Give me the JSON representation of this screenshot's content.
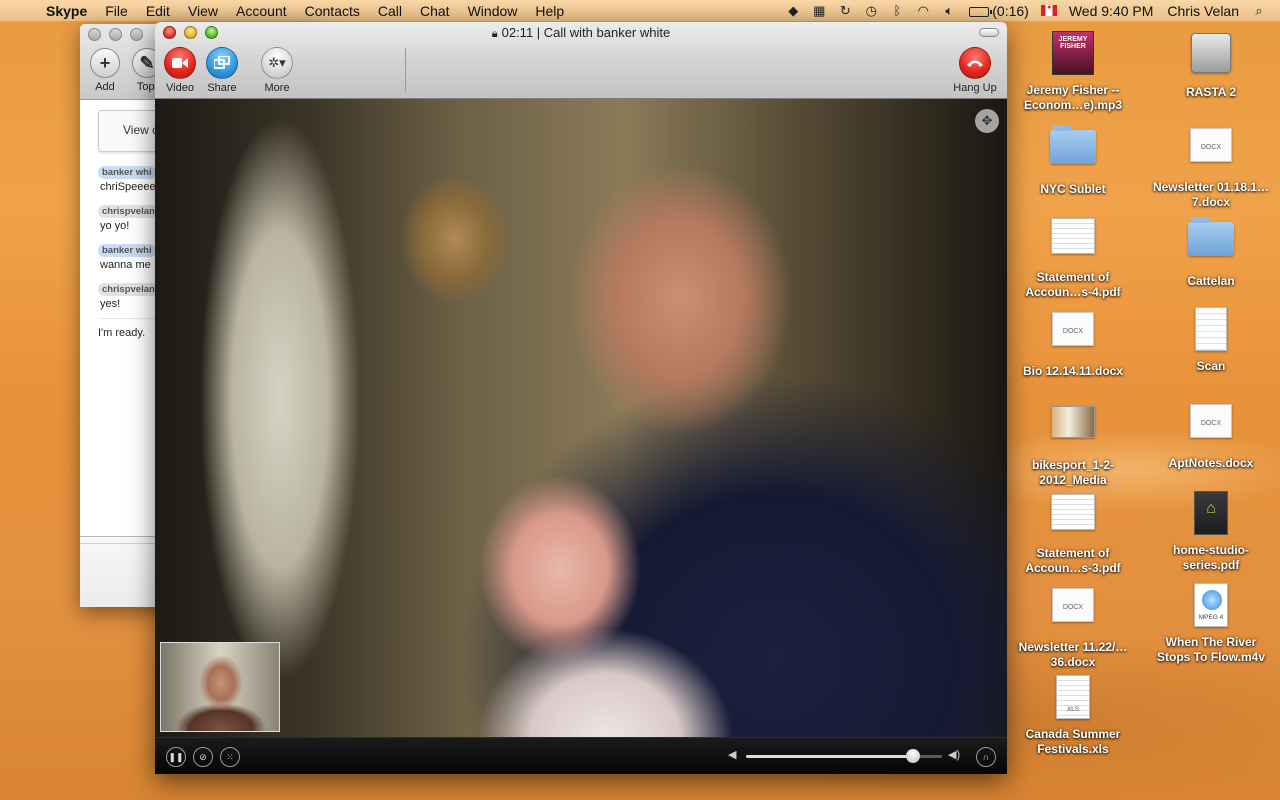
{
  "menubar": {
    "app_name": "Skype",
    "items": [
      "File",
      "Edit",
      "View",
      "Account",
      "Contacts",
      "Call",
      "Chat",
      "Window",
      "Help"
    ],
    "battery_time": "(0:16)",
    "clock": "Wed 9:40 PM",
    "user": "Chris Velan"
  },
  "skype_main": {
    "toolbar": {
      "add_label": "Add",
      "topic_label": "Topi"
    },
    "view_button_label": "View c",
    "chat": [
      {
        "name": "banker whi",
        "message": "chriSpeeee",
        "self": false
      },
      {
        "name": "chrispvelan",
        "message": "yo yo!",
        "self": true
      },
      {
        "name": "banker whi",
        "message": "wanna me",
        "self": false
      },
      {
        "name": "chrispvelan",
        "message": "yes!",
        "self": true
      }
    ],
    "ready_text": "I'm ready."
  },
  "call_window": {
    "title": "02:11 | Call with banker white",
    "toolbar": {
      "video_label": "Video",
      "share_label": "Share",
      "more_label": "More",
      "hangup_label": "Hang Up"
    },
    "volume_level": 0.85
  },
  "desktop_icons": [
    {
      "label": "Jeremy Fisher -- Econom…e).mp3",
      "type": "album",
      "art_text": "JEREMY FISHER"
    },
    {
      "label": "RASTA 2",
      "type": "disk"
    },
    {
      "label": "NYC Sublet",
      "type": "folder"
    },
    {
      "label": "Newsletter 01.18.1…7.docx",
      "type": "docx",
      "badge": "DOCX"
    },
    {
      "label": "Statement of Accoun…s-4.pdf",
      "type": "sheet"
    },
    {
      "label": "Cattelan",
      "type": "folder"
    },
    {
      "label": "Bio 12.14.11.docx",
      "type": "docx",
      "badge": "DOCX"
    },
    {
      "label": "Scan",
      "type": "scan"
    },
    {
      "label": "bikesport_1-2-2012_Media",
      "type": "media"
    },
    {
      "label": "AptNotes.docx",
      "type": "docx",
      "badge": "DOCX"
    },
    {
      "label": "Statement of Accoun…s-3.pdf",
      "type": "sheet"
    },
    {
      "label": "home-studio-series.pdf",
      "type": "pdfdark"
    },
    {
      "label": "Newsletter 11.22/…36.docx",
      "type": "docx",
      "badge": "DOCX"
    },
    {
      "label": "When The River Stops To Flow.m4v",
      "type": "mpeg",
      "badge": "MPEG 4"
    },
    {
      "label": "Canada Summer Festivals.xls",
      "type": "xls",
      "badge": "XLS"
    }
  ]
}
